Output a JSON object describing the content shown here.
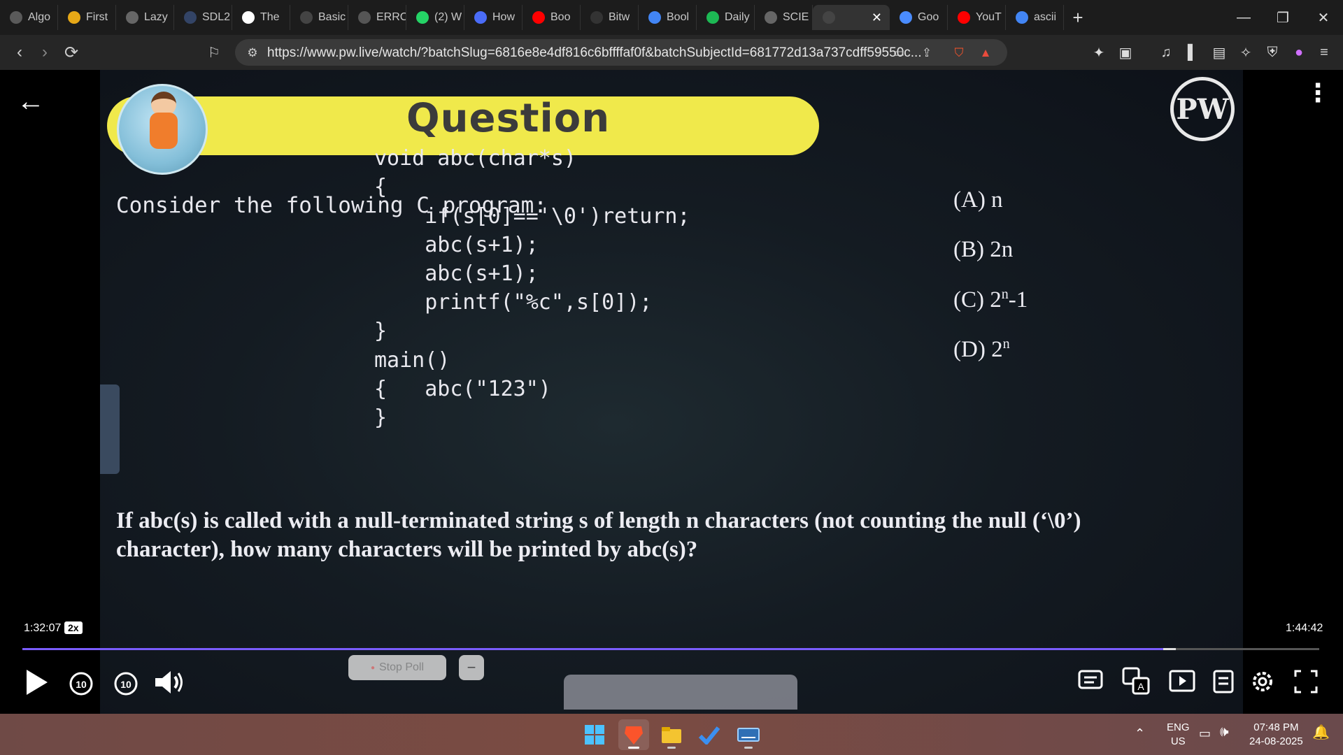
{
  "browser": {
    "tabs": [
      {
        "label": "Algo",
        "icon": "chatgpt-icon",
        "color": "#5a5a5a"
      },
      {
        "label": "First",
        "icon": "stack-icon",
        "color": "#e6a817"
      },
      {
        "label": "Lazy",
        "icon": "globe-icon",
        "color": "#666"
      },
      {
        "label": "SDL2",
        "icon": "sdl-icon",
        "color": "#334466"
      },
      {
        "label": "The",
        "icon": "w3-icon",
        "color": "#ffffff"
      },
      {
        "label": "Basic",
        "icon": "code-icon",
        "color": "#444"
      },
      {
        "label": "ERRC",
        "icon": "globe-icon",
        "color": "#555"
      },
      {
        "label": "(2) W",
        "icon": "whatsapp-icon",
        "color": "#25d366"
      },
      {
        "label": "How",
        "icon": "bookmark-icon",
        "color": "#4a6cf7"
      },
      {
        "label": "Boo",
        "icon": "youtube-icon",
        "color": "#ff0000"
      },
      {
        "label": "Bitw",
        "icon": "origin-icon",
        "color": "#333"
      },
      {
        "label": "Bool",
        "icon": "google-icon",
        "color": "#4285f4"
      },
      {
        "label": "Daily",
        "icon": "spotify-icon",
        "color": "#1db954"
      },
      {
        "label": "SCIE",
        "icon": "globe-icon",
        "color": "#666"
      }
    ],
    "active_tab": {
      "label": "",
      "close": "✕"
    },
    "tabs_after": [
      {
        "label": "Goo",
        "icon": "gemini-icon",
        "color": "#4a8cff"
      },
      {
        "label": "YouT",
        "icon": "youtube-icon",
        "color": "#ff0000"
      },
      {
        "label": "ascii",
        "icon": "google-icon",
        "color": "#4285f4"
      }
    ],
    "new_tab": "+",
    "url": "https://www.pw.live/watch/?batchSlug=6816e8e4df816c6bffffaf0f&batchSubjectId=681772d13a737cdff59550c...",
    "brave_badge": "3"
  },
  "slide": {
    "title": "Question",
    "logo": "PW",
    "intro": "Consider the following C program:",
    "code_lines": [
      "void abc(char*s)",
      "{",
      "    if(s[0]=='\\0')return;",
      "    abc(s+1);",
      "    abc(s+1);",
      "    printf(\"%c\",s[0]);",
      "}",
      "main()",
      "{   abc(\"123\")",
      "}"
    ],
    "options": [
      {
        "key": "(A) n",
        "base": "",
        "sup": "",
        "tail": ""
      },
      {
        "key": "(B) 2n",
        "base": "",
        "sup": "",
        "tail": ""
      },
      {
        "key": "(C) ",
        "base": "2",
        "sup": "n",
        "tail": "-1"
      },
      {
        "key": "(D) ",
        "base": "2",
        "sup": "n",
        "tail": ""
      }
    ],
    "question": "If abc(s) is called with a null-terminated string s of length n characters (not counting the null (‘\\0’) character), how many characters will be printed by abc(s)?"
  },
  "player": {
    "elapsed": "1:32:07",
    "speed": "2x",
    "duration": "1:44:42",
    "progress_fraction": 0.8797,
    "stop_poll": "Stop Poll",
    "accent": "#7a5cff"
  },
  "taskbar": {
    "lang_top": "ENG",
    "lang_bottom": "US",
    "time": "07:48 PM",
    "date": "24-08-2025"
  }
}
